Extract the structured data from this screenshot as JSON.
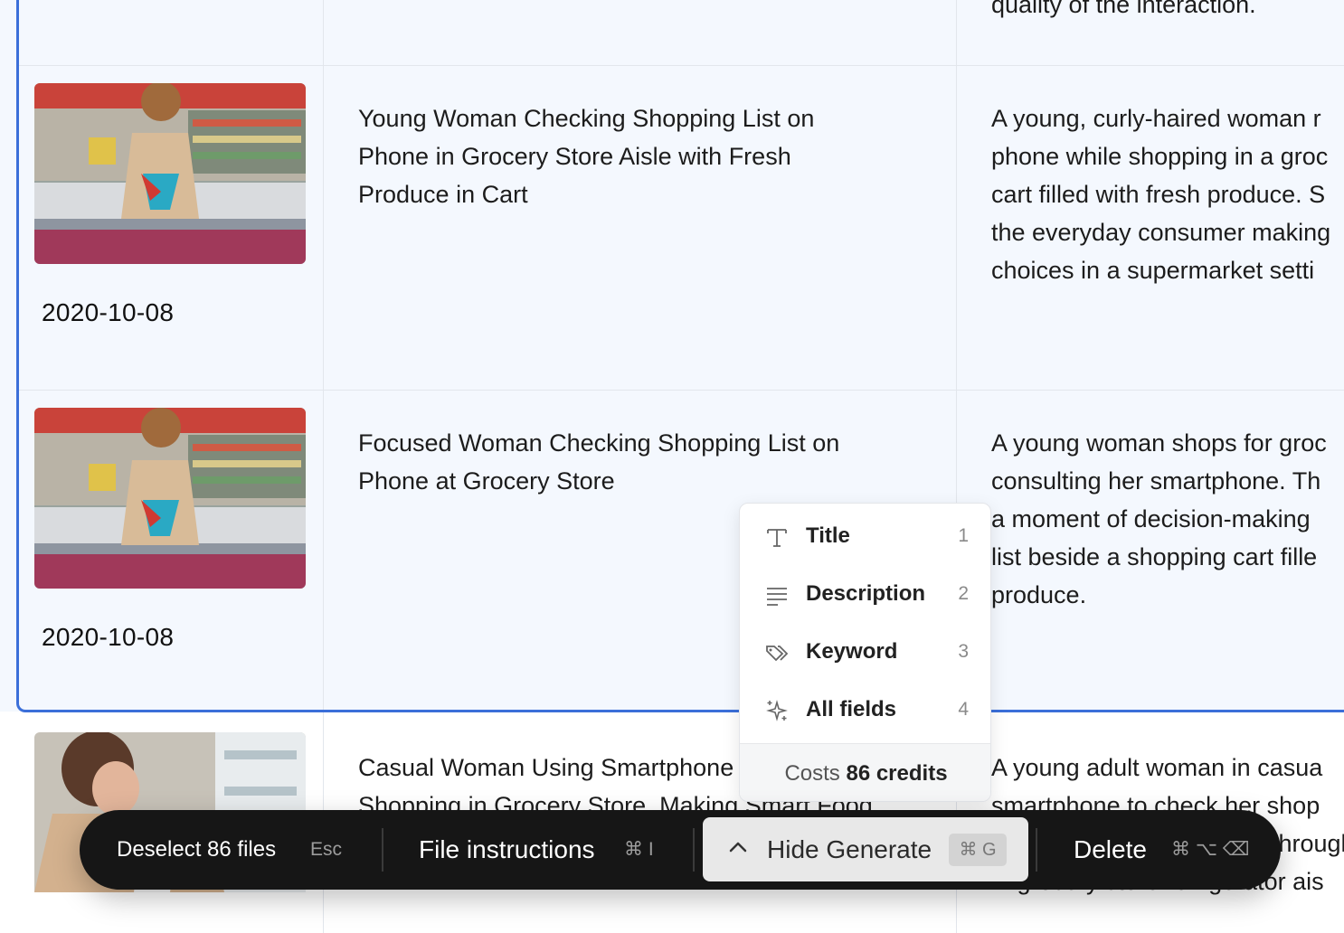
{
  "rows": [
    {
      "date": "",
      "title": [],
      "description": [
        "quality of the interaction."
      ]
    },
    {
      "date": "2020-10-08",
      "title": [
        "Young Woman Checking Shopping List on",
        "Phone in Grocery Store Aisle with Fresh",
        "Produce in Cart"
      ],
      "description": [
        "A young, curly-haired woman r",
        "phone while shopping in a groc",
        "cart filled with fresh produce. S",
        "the everyday consumer making",
        "choices in a supermarket setti"
      ]
    },
    {
      "date": "2020-10-08",
      "title": [
        "Focused Woman Checking Shopping List on",
        "Phone at Grocery Store"
      ],
      "description": [
        "A young woman shops for groc",
        "consulting her smartphone. Th",
        "a moment of decision-making",
        "list beside a shopping cart fille",
        "produce."
      ]
    },
    {
      "date": "",
      "title": [
        "Casual Woman Using Smartphone",
        "Shopping in Grocery Store, Making Smart Food"
      ],
      "description": [
        "A young adult woman in casua",
        "smartphone to check her shop",
        "through i",
        "in grocery store refrigerator ais"
      ]
    }
  ],
  "generate_menu": {
    "items": [
      {
        "label": "Title",
        "shortcut": "1",
        "icon": "text-t-icon"
      },
      {
        "label": "Description",
        "shortcut": "2",
        "icon": "lines-icon"
      },
      {
        "label": "Keyword",
        "shortcut": "3",
        "icon": "tags-icon"
      },
      {
        "label": "All fields",
        "shortcut": "4",
        "icon": "sparkle-icon"
      }
    ],
    "cost_prefix": "Costs",
    "cost_value": "86 credits"
  },
  "toolbar": {
    "deselect_label": "Deselect 86 files",
    "deselect_shortcut": "Esc",
    "instructions_label": "File instructions",
    "instructions_shortcut": "⌘ I",
    "generate_label": "Hide Generate",
    "generate_shortcut": "⌘ G",
    "delete_label": "Delete",
    "delete_shortcut": "⌘ ⌥ ⌫"
  },
  "colors": {
    "selection_border": "#3b6fd9",
    "selected_row_bg": "#f4f8fe",
    "toolbar_bg": "#161616"
  }
}
